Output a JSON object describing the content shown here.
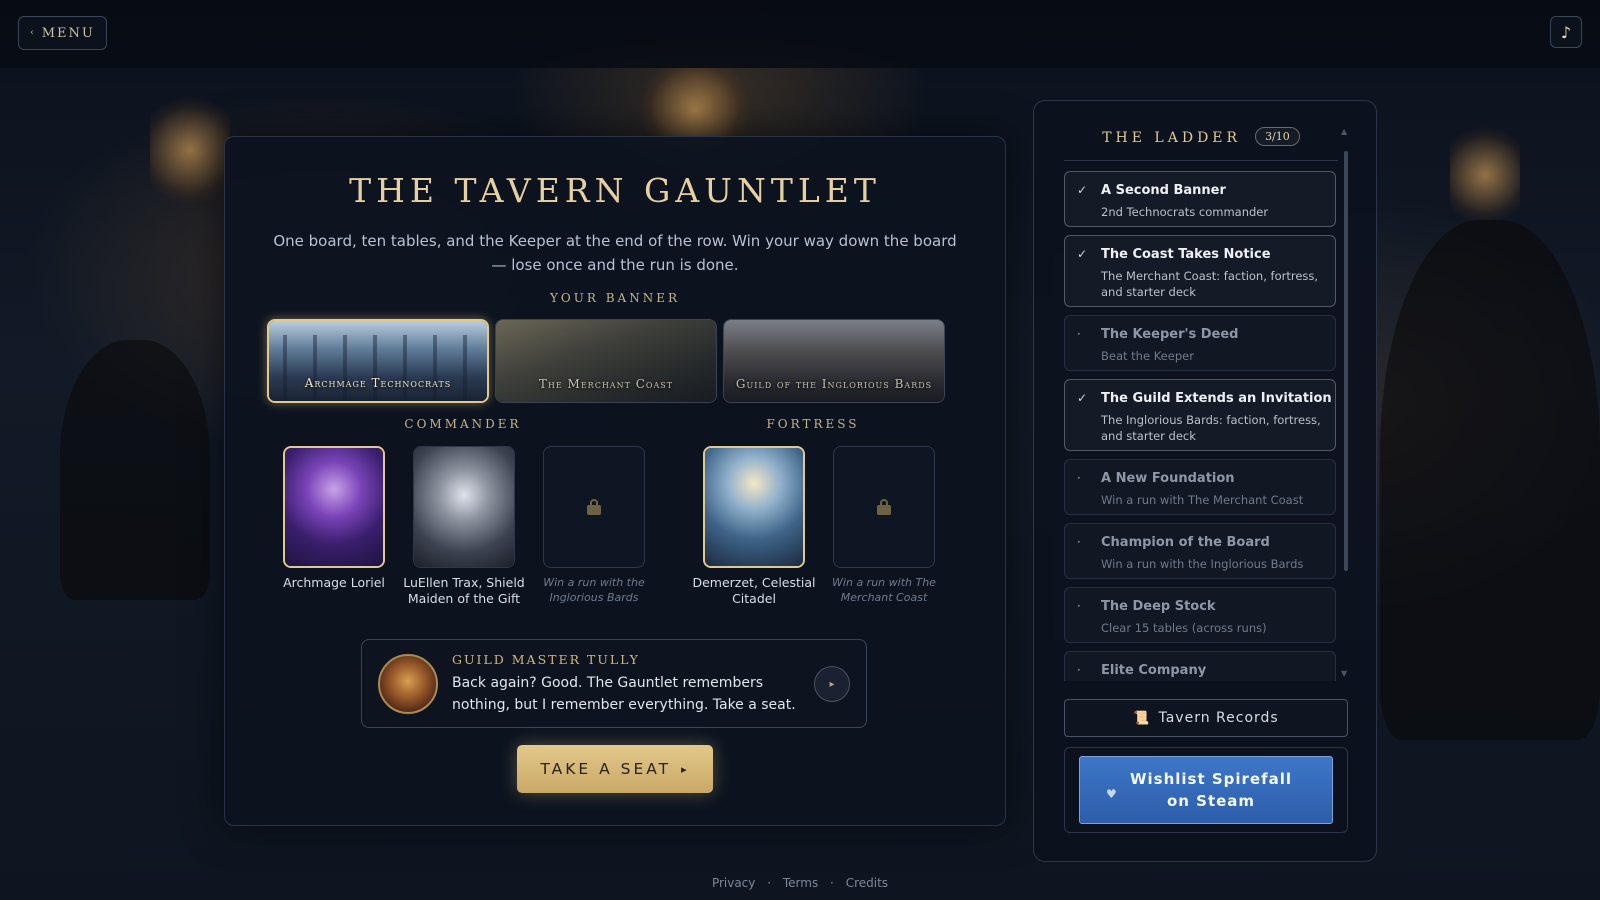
{
  "topbar": {
    "menu_label": "MENU",
    "menu_icon": "chevron-left",
    "music_icon": "♪"
  },
  "main": {
    "title": "THE TAVERN GAUNTLET",
    "subtitle": "One board, ten tables, and the Keeper at the end of the row. Win your way down the board — lose once and the run is done.",
    "banner_label": "YOUR BANNER",
    "banners": [
      {
        "name": "Archmage Technocrats",
        "selected": true
      },
      {
        "name": "The Merchant Coast",
        "selected": false
      },
      {
        "name": "Guild of the Inglorious Bards",
        "selected": false
      }
    ],
    "commander_label": "COMMANDER",
    "fortress_label": "FORTRESS",
    "commanders": [
      {
        "name": "Archmage Loriel",
        "selected": true,
        "locked": false
      },
      {
        "name": "LuEllen Trax, Shield Maiden of the Gift",
        "selected": false,
        "locked": false
      },
      {
        "name": "Win a run with the Inglorious Bards",
        "selected": false,
        "locked": true
      }
    ],
    "fortresses": [
      {
        "name": "Demerzet, Celestial Citadel",
        "selected": true,
        "locked": false
      },
      {
        "name": "Win a run with The Merchant Coast",
        "selected": false,
        "locked": true
      }
    ],
    "dialog": {
      "speaker": "GUILD MASTER TULLY",
      "line": "Back again? Good. The Gauntlet remembers nothing, but I remember everything. Take a seat."
    },
    "cta_label": "TAKE A SEAT",
    "cta_arrow": "▸"
  },
  "ladder": {
    "title": "THE LADDER",
    "count": "3/10",
    "items": [
      {
        "name": "A Second Banner",
        "desc": "2nd Technocrats commander",
        "done": true
      },
      {
        "name": "The Coast Takes Notice",
        "desc": "The Merchant Coast: faction, fortress, and starter deck",
        "done": true
      },
      {
        "name": "The Keeper's Deed",
        "desc": "Beat the Keeper",
        "done": false
      },
      {
        "name": "The Guild Extends an Invitation",
        "desc": "The Inglorious Bards: faction, fortress, and starter deck",
        "done": true
      },
      {
        "name": "A New Foundation",
        "desc": "Win a run with The Merchant Coast",
        "done": false
      },
      {
        "name": "Champion of the Board",
        "desc": "Win a run with the Inglorious Bards",
        "done": false
      },
      {
        "name": "The Deep Stock",
        "desc": "Clear 15 tables (across runs)",
        "done": false
      },
      {
        "name": "Elite Company",
        "desc": "",
        "done": false
      }
    ],
    "records_label": "Tavern Records",
    "records_icon": "📜",
    "wishlist_label": "Wishlist Spirefall on Steam",
    "wishlist_icon": "♥"
  },
  "footer": {
    "privacy": "Privacy",
    "terms": "Terms",
    "credits": "Credits",
    "sep": "·"
  },
  "colors": {
    "accent_gold": "#e3c88b",
    "steam_blue": "#3f76c8",
    "panel": "#0c131f"
  }
}
